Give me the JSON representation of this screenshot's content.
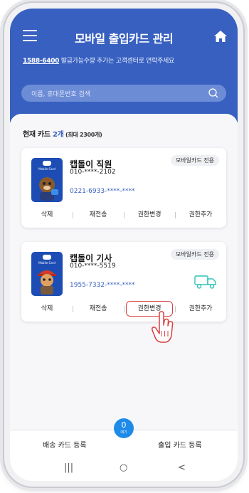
{
  "header": {
    "title": "모바일 출입카드 관리",
    "phone_link": "1588-6400",
    "info_text": " 발급가능수량 추가는 고객센터로 연락주세요"
  },
  "search": {
    "placeholder": "이름, 휴대폰번호 검색"
  },
  "summary": {
    "label": "현재 카드 ",
    "count": "2개",
    "max": " (최대 2300개)"
  },
  "cards": [
    {
      "name": "캡돌이 직원",
      "phone": "010-****-2102",
      "card_number": "0221-6933-****-****",
      "badge": "모바일카드 전용",
      "thumb_brand": "Mobile Card",
      "thumb_color": "#1d4db4",
      "actions": [
        "삭제",
        "재전송",
        "권한변경",
        "권한추가"
      ]
    },
    {
      "name": "캡돌이 기사",
      "phone": "010-****-5519",
      "card_number": "1955-7332-****-****",
      "badge": "모바일카드 전용",
      "thumb_brand": "Mobile Card",
      "thumb_color": "#1d4db4",
      "icon": "delivery-truck-icon",
      "actions": [
        "삭제",
        "재전송",
        "권한변경",
        "권한추가"
      ],
      "highlighted_action": "권한변경"
    }
  ],
  "bottom": {
    "left_button": "배송 카드 등록",
    "right_button": "출입 카드 등록",
    "fab_count": "0",
    "fab_label": "대기"
  },
  "system_nav": {
    "recents": "|||",
    "home": "○",
    "back": "<"
  },
  "colors": {
    "primary": "#3760c0",
    "fab": "#1e8be8",
    "highlight": "#d94040",
    "truck": "#2ec4b6"
  }
}
